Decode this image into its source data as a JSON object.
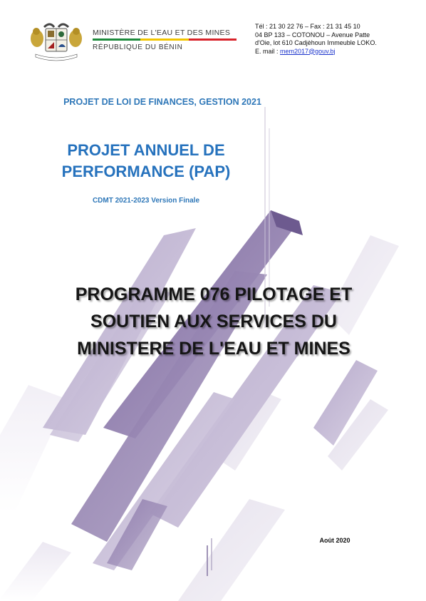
{
  "header": {
    "ministry": "MINISTÈRE DE L'EAU ET DES MINES",
    "country": "RÉPUBLIQUE DU BÉNIN",
    "emblem_motto": "FRATERNITÉ · JUSTICE · TRAVAIL"
  },
  "contact": {
    "line1": "Tél : 21 30 22 76 – Fax : 21 31 45 10",
    "line2": "04 BP 133 – COTONOU – Avenue Patte",
    "line3": "d'Oie, lot 610 Cadjèhoun Immeuble LOKO.",
    "email_label": "E. mail : ",
    "email": "mem2017@gouv.bj"
  },
  "document": {
    "law_title": "PROJET DE LOI DE FINANCES, GESTION 2021",
    "pap_line1": "PROJET ANNUEL DE",
    "pap_line2": "PERFORMANCE (PAP)",
    "version": "CDMT 2021-2023 Version Finale",
    "program_line1": "PROGRAMME 076 PILOTAGE ET",
    "program_line2": "SOUTIEN AUX SERVICES DU",
    "program_line3": "MINISTERE DE L'EAU ET MINES",
    "date": "Août 2020"
  },
  "colors": {
    "title_blue": "#2672bd",
    "shape_purple": "#8a78a6",
    "shape_light": "#d8d2e2",
    "flag_green": "#1e8a3c",
    "flag_yellow": "#f2c500",
    "flag_red": "#d8232a"
  }
}
